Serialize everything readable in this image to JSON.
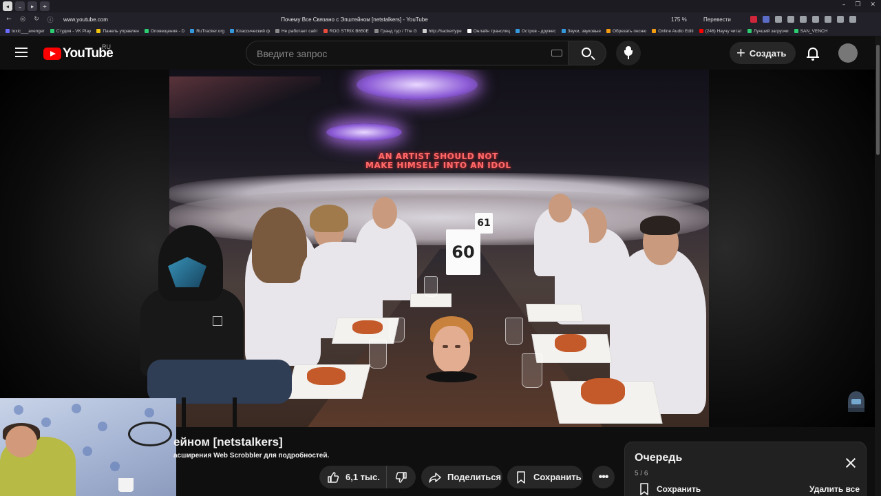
{
  "browser": {
    "url": "www.youtube.com",
    "page_title": "Почему Все Связано с Эпштейном [netstalkers] - YouTube",
    "zoom": "175 %",
    "translate_label": "Перевести",
    "bookmarks": [
      {
        "label": "toxic___avenger",
        "color": "#6b6bff"
      },
      {
        "label": "Студия - VK Play",
        "color": "#2ecc71"
      },
      {
        "label": "Панель управлен",
        "color": "#f1c40f"
      },
      {
        "label": "Оповещения - D",
        "color": "#2ecc71"
      },
      {
        "label": "RuTracker.org",
        "color": "#3498db"
      },
      {
        "label": "Классический ф",
        "color": "#3498db"
      },
      {
        "label": "Не работает сайт",
        "color": "#888888"
      },
      {
        "label": "ROG STRIX B650E",
        "color": "#e74c3c"
      },
      {
        "label": "Гранд тур / The G",
        "color": "#888888"
      },
      {
        "label": "http://hackertype",
        "color": "#cccccc"
      },
      {
        "label": "Онлайн трансляц",
        "color": "#ffffff"
      },
      {
        "label": "Остров - дружес",
        "color": "#3498db"
      },
      {
        "label": "Звуки, звуковые",
        "color": "#3498db"
      },
      {
        "label": "Обрезать песню",
        "color": "#f39c12"
      },
      {
        "label": "Online Audio Editi",
        "color": "#f39c12"
      },
      {
        "label": "(246) Научу читат",
        "color": "#ff0000"
      },
      {
        "label": "Лучший загрузчи",
        "color": "#2ecc71"
      },
      {
        "label": "SAN_VENCH",
        "color": "#2ecc71"
      }
    ]
  },
  "header": {
    "logo_text": "YouTube",
    "country": "RU",
    "search_placeholder": "Введите запрос",
    "create_label": "Создать"
  },
  "video": {
    "sign_line1": "AN ARTIST SHOULD NOT",
    "sign_line2": "MAKE HIMSELF INTO AN IDOL",
    "card_60": "60",
    "card_61": "61",
    "title": "ейном [netstalkers]",
    "scrobbler_note": "асширения Web Scrobbler для подробностей."
  },
  "actions": {
    "likes": "6,1 тыс.",
    "share": "Поделиться",
    "save": "Сохранить",
    "more": "•••"
  },
  "queue": {
    "title": "Очередь",
    "count": "5 / 6",
    "save": "Сохранить",
    "delete_all": "Удалить все"
  },
  "colors": {
    "background": "#0f0f0f",
    "pill": "#272727",
    "youtube_red": "#ff0000"
  }
}
